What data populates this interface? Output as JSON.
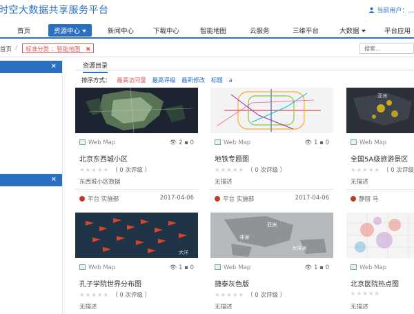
{
  "header": {
    "site_title": "时空大数据共享服务平台",
    "user_label": "当前用户：..."
  },
  "nav": {
    "items": [
      {
        "label": "首页"
      },
      {
        "label": "资源中心"
      },
      {
        "label": "新闻中心"
      },
      {
        "label": "下载中心"
      },
      {
        "label": "智能地图"
      },
      {
        "label": "云服务"
      },
      {
        "label": "三维平台"
      },
      {
        "label": "大数据"
      },
      {
        "label": "平台应用"
      }
    ]
  },
  "breadcrumb": {
    "home": "首页",
    "separator": "/",
    "filter_tag": "标准分类 ：智能地图",
    "filter_close": "✖"
  },
  "search": {
    "placeholder": "搜索..."
  },
  "sidebar": {
    "close_symbol": "✕"
  },
  "main": {
    "tab": "资源目录",
    "sort_label": "排序方式：",
    "sort_options": [
      "最高访问量",
      "最高评级",
      "最新修改",
      "标题"
    ],
    "sort_options_suffix": "a"
  },
  "colors": {
    "accent": "#2a6fc0",
    "danger": "#e05a5a"
  },
  "cards": [
    {
      "type": "Web Map",
      "views": "2",
      "comments": "0",
      "title": "北京东西城小区",
      "rating_text": "（ 0 次评级 ）",
      "desc": "东西城小区数据",
      "owner": "平台 实施部",
      "date": "2017-04-06",
      "thumb_icon": "dark-satellite-map"
    },
    {
      "type": "Web Map",
      "views": "1",
      "comments": "0",
      "title": "地铁专题图",
      "rating_text": "（ 0 次评级 ）",
      "desc": "无描述",
      "owner": "平台 实施部",
      "date": "2017-04-06",
      "thumb_icon": "subway-map"
    },
    {
      "type": "Web Map",
      "views": "1",
      "comments": "0",
      "title": "全国5A级旅游景区",
      "rating_text": "（ 0 次评级 ）",
      "desc": "无描述",
      "owner": "静丽 马",
      "date": "",
      "thumb_icon": "dark-world-map",
      "thumb_text": "亚洲"
    },
    {
      "type": "Web Map",
      "views": "1",
      "comments": "0",
      "title": "孔子学院世界分布图",
      "rating_text": "（ 0 次评级 ）",
      "desc": "无描述",
      "owner": "",
      "date": "",
      "thumb_icon": "flag-map",
      "thumb_text": "大洋"
    },
    {
      "type": "Web Map",
      "views": "1",
      "comments": "0",
      "title": "捷泰灰色版",
      "rating_text": "（ 0 次评级 ）",
      "desc": "无描述",
      "owner": "",
      "date": "",
      "thumb_icon": "gray-world-map",
      "thumb_labels": [
        "亚洲",
        "非洲",
        "大洋洲"
      ]
    },
    {
      "type": "Web Map",
      "views": "",
      "comments": "",
      "title": "北京医院热点图",
      "rating_text": "",
      "desc": "无描述",
      "owner": "",
      "date": "",
      "thumb_icon": "heat-map"
    }
  ]
}
